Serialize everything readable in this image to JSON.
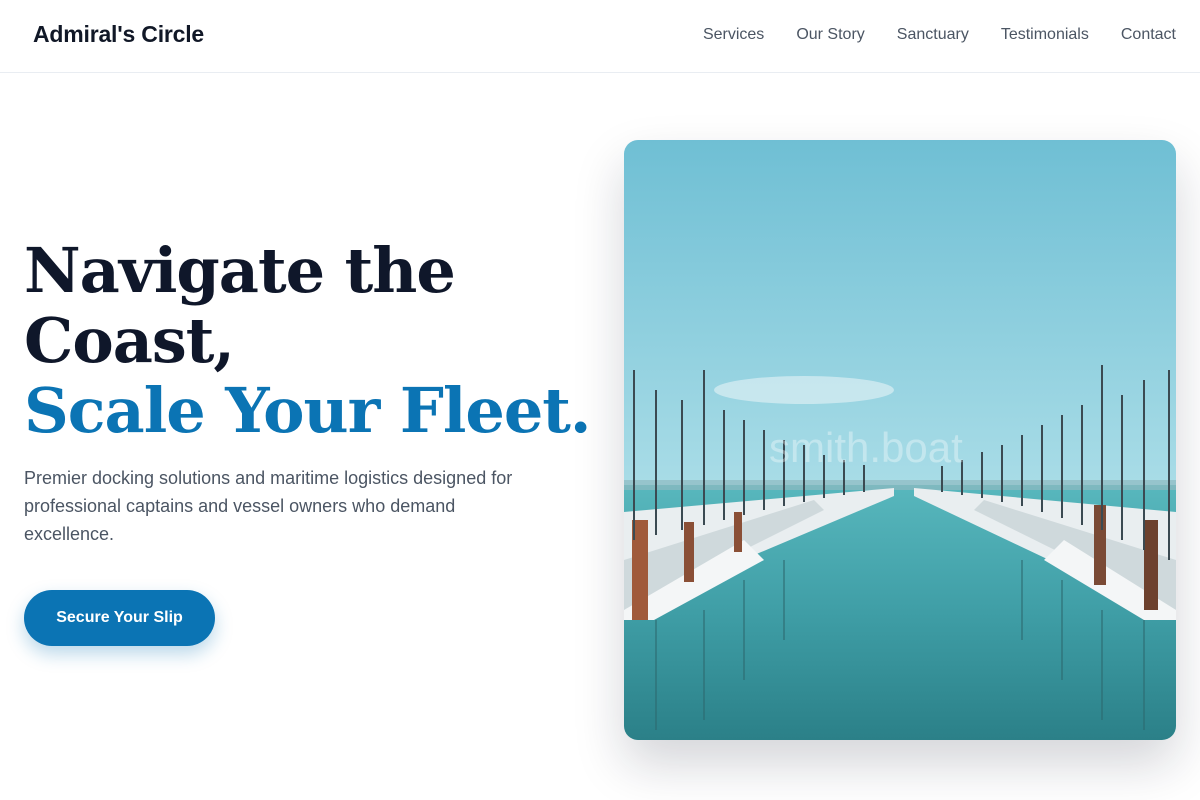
{
  "nav": {
    "brand": "Admiral's Circle",
    "links": [
      "Services",
      "Our Story",
      "Sanctuary",
      "Testimonials",
      "Contact"
    ]
  },
  "hero": {
    "headline_line1": "Navigate the",
    "headline_line2": "Coast,",
    "headline_accent": "Scale Your Fleet.",
    "lede": "Premier docking solutions and maritime logistics designed for professional captains and vessel owners who demand excellence.",
    "cta_label": "Secure Your Slip",
    "image_watermark": "smith.boat"
  },
  "colors": {
    "accent": "#0b74b4",
    "heading": "#0f172a",
    "body_text": "#4b5563"
  },
  "icons": {
    "hero_image": "marina-photo"
  }
}
